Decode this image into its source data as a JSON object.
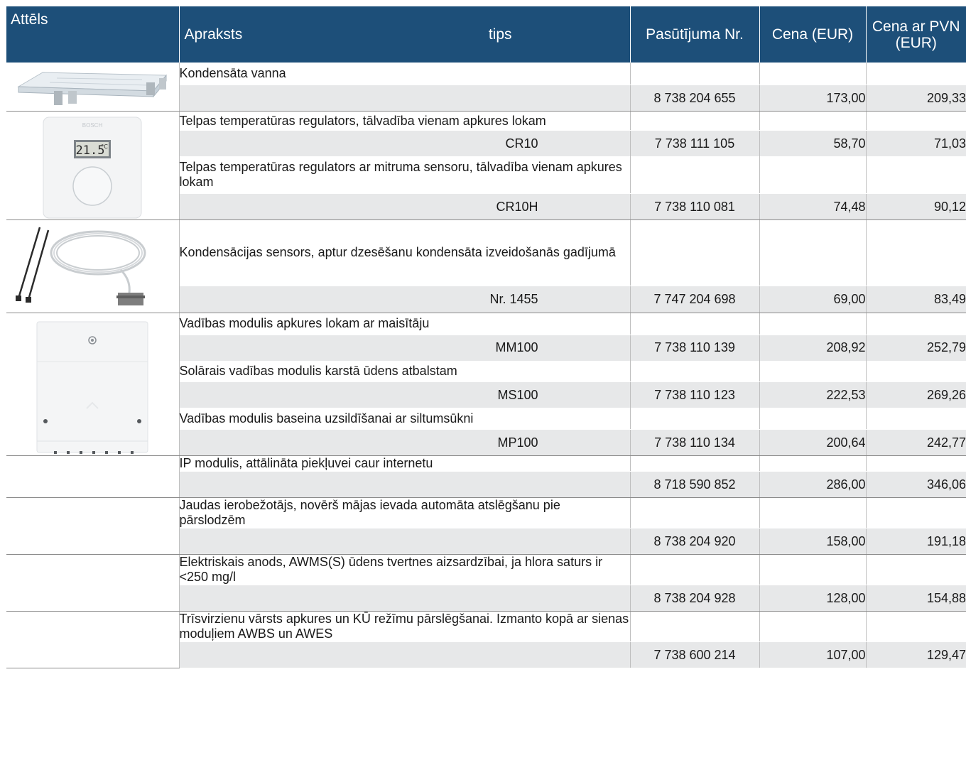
{
  "header": {
    "image": "Attēls",
    "description": "Apraksts",
    "type": "tips",
    "order": "Pasūtījuma Nr.",
    "price": "Cena (EUR)",
    "price_vat_line1": "Cena ar PVN",
    "price_vat_line2": "(EUR)"
  },
  "rows": [
    {
      "desc": "Kondensāta vanna",
      "type": "",
      "order": "8 738 204 655",
      "price": "173,00",
      "vat": "209,33"
    },
    {
      "desc": "Telpas temperatūras regulators, tālvadība vienam apkures lokam",
      "type": "CR10",
      "order": "7 738 111 105",
      "price": "58,70",
      "vat": "71,03"
    },
    {
      "desc": "Telpas temperatūras regulators ar mitruma sensoru, tālvadība vienam apkures lokam",
      "type": "CR10H",
      "order": "7 738 110 081",
      "price": "74,48",
      "vat": "90,12"
    },
    {
      "desc": "Kondensācijas sensors, aptur dzesēšanu kondensāta izveidošanās gadījumā",
      "type": "Nr. 1455",
      "order": "7 747 204 698",
      "price": "69,00",
      "vat": "83,49"
    },
    {
      "desc": "Vadības modulis apkures lokam ar maisītāju",
      "type": "MM100",
      "order": "7 738 110 139",
      "price": "208,92",
      "vat": "252,79"
    },
    {
      "desc": "Solārais vadības modulis karstā ūdens atbalstam",
      "type": "MS100",
      "order": "7 738 110 123",
      "price": "222,53",
      "vat": "269,26"
    },
    {
      "desc": "Vadības modulis baseina uzsildīšanai ar siltumsūkni",
      "type": "MP100",
      "order": "7 738 110 134",
      "price": "200,64",
      "vat": "242,77"
    },
    {
      "desc": "IP modulis, attālināta piekļuvei caur internetu",
      "type": "",
      "order": "8 718 590 852",
      "price": "286,00",
      "vat": "346,06"
    },
    {
      "desc": "Jaudas ierobežotājs, novērš mājas ievada automāta atslēgšanu pie pārslodzēm",
      "type": "",
      "order": "8 738 204 920",
      "price": "158,00",
      "vat": "191,18"
    },
    {
      "desc": "Elektriskais anods, AWMS(S) ūdens tvertnes aizsardzībai, ja hlora saturs ir <250 mg/l",
      "type": "",
      "order": "8 738 204 928",
      "price": "128,00",
      "vat": "154,88"
    },
    {
      "desc": "Trīsvirzienu vārsts apkures un KŪ režīmu pārslēgšanai. Izmanto kopā ar sienas moduļiem AWBS un AWES",
      "type": "",
      "order": "7 738 600 214",
      "price": "107,00",
      "vat": "129,47"
    }
  ],
  "images": {
    "thermostat_display": "21.5",
    "thermostat_unit": "°C",
    "thermostat_brand": "BOSCH"
  },
  "icons": [
    "condensate-tray-image",
    "thermostat-image",
    "condensation-sensor-image",
    "control-module-image"
  ],
  "colors": {
    "header_bg": "#1d4f79",
    "header_text": "#ffffff",
    "price_row_bg": "#e7e8e9",
    "divider": "#8a8a8a"
  }
}
